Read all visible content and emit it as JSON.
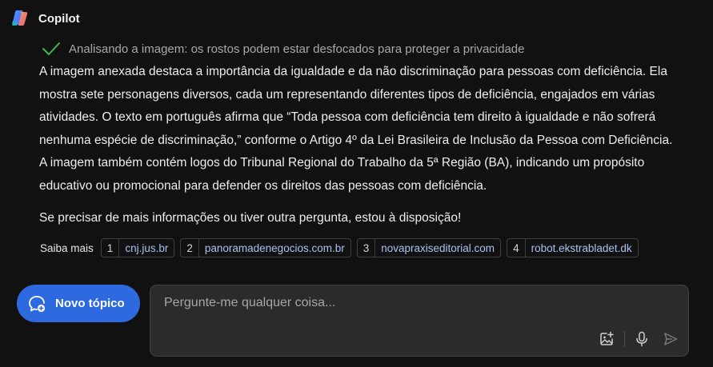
{
  "app": {
    "name": "Copilot"
  },
  "status": {
    "text": "Analisando a imagem: os rostos podem estar desfocados para proteger a privacidade"
  },
  "answer": {
    "paragraphs": [
      "A imagem anexada destaca a importância da igualdade e da não discriminação para pessoas com deficiência. Ela mostra sete personagens diversos, cada um representando diferentes tipos de deficiência, engajados em várias atividades. O texto em português afirma que “Toda pessoa com deficiência tem direito à igualdade e não sofrerá nenhuma espécie de discriminação,” conforme o Artigo 4º da Lei Brasileira de Inclusão da Pessoa com Deficiência. A imagem também contém logos do Tribunal Regional do Trabalho da 5ª Região (BA), indicando um propósito educativo ou promocional para defender os direitos das pessoas com deficiência.",
      "Se precisar de mais informações ou tiver outra pergunta, estou à disposição!"
    ]
  },
  "sources": {
    "label": "Saiba mais",
    "items": [
      {
        "num": "1",
        "label": "cnj.jus.br"
      },
      {
        "num": "2",
        "label": "panoramadenegocios.com.br"
      },
      {
        "num": "3",
        "label": "novapraxiseditorial.com"
      },
      {
        "num": "4",
        "label": "robot.ekstrabladet.dk"
      }
    ]
  },
  "new_topic": {
    "label": "Novo tópico"
  },
  "composer": {
    "placeholder": "Pergunte-me qualquer coisa...",
    "value": ""
  },
  "icons": {
    "logo": "copilot-logo",
    "status": "check-icon",
    "new_topic": "new-chat-icon",
    "image": "image-add-icon",
    "mic": "microphone-icon",
    "send": "send-icon"
  },
  "colors": {
    "background": "#111111",
    "accent": "#2d6ae0",
    "check": "#3fb950",
    "link": "#a9c1f0",
    "composer_bg": "#2b2b2b"
  }
}
